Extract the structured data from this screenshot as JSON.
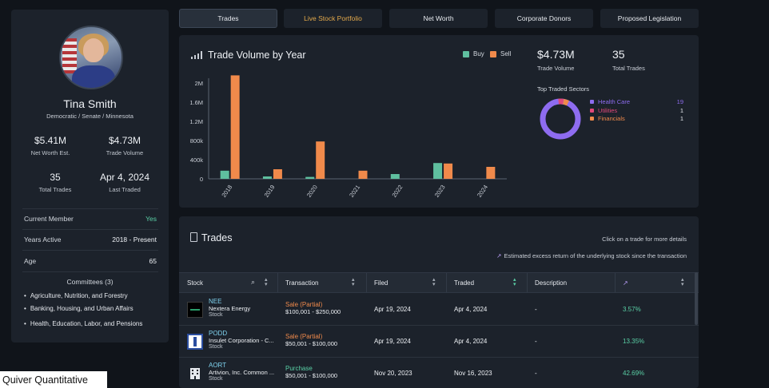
{
  "tabs": [
    "Trades",
    "Live Stock Portfolio",
    "Net Worth",
    "Corporate Donors",
    "Proposed Legislation"
  ],
  "profile": {
    "name": "Tina Smith",
    "subtitle": "Democratic / Senate / Minnesota",
    "net_worth": "$5.41M",
    "net_worth_label": "Net Worth Est.",
    "trade_volume": "$4.73M",
    "trade_volume_label": "Trade Volume",
    "total_trades": "35",
    "total_trades_label": "Total Trades",
    "last_traded": "Apr 4, 2024",
    "last_traded_label": "Last Traded",
    "current_member_label": "Current Member",
    "current_member": "Yes",
    "years_active_label": "Years Active",
    "years_active": "2018 - Present",
    "age_label": "Age",
    "age": "65",
    "committees_title": "Committees (3)",
    "committees": [
      "Agriculture, Nutrition, and Forestry",
      "Banking, Housing, and Urban Affairs",
      "Health, Education, Labor, and Pensions"
    ]
  },
  "summary": {
    "trade_volume": "$4.73M",
    "trade_volume_label": "Trade Volume",
    "total_trades": "35",
    "total_trades_label": "Total Trades",
    "sectors_title": "Top Traded Sectors",
    "sectors": [
      {
        "name": "Health Care",
        "count": "19",
        "color": "#8e6cf0"
      },
      {
        "name": "Utilities",
        "count": "1",
        "color": "#e0487a"
      },
      {
        "name": "Financials",
        "count": "1",
        "color": "#f08a4b"
      }
    ]
  },
  "chart_data": {
    "type": "bar",
    "title": "Trade Volume by Year",
    "categories": [
      "2018",
      "2019",
      "2020",
      "2021",
      "2022",
      "2023",
      "2024"
    ],
    "series": [
      {
        "name": "Buy",
        "color": "#5fbf9f",
        "values": [
          170000,
          50000,
          40000,
          0,
          100000,
          330000,
          0
        ]
      },
      {
        "name": "Sell",
        "color": "#f08a4b",
        "values": [
          2160000,
          200000,
          780000,
          170000,
          0,
          320000,
          250000
        ]
      }
    ],
    "y_ticks": [
      "0",
      "400k",
      "800k",
      "1.2M",
      "1.6M",
      "2M"
    ],
    "ylim": [
      0,
      2400000
    ],
    "legend": "top-right"
  },
  "trades": {
    "title": "Trades",
    "hint1": "Click on a trade for more details",
    "hint2": "Estimated excess return of the underlying stock since the transaction",
    "columns": [
      "Stock",
      "Transaction",
      "Filed",
      "Traded",
      "Description"
    ],
    "rows": [
      {
        "ticker": "NEE",
        "company": "Nextera Energy",
        "type": "Stock",
        "transaction": "Sale (Partial)",
        "amount": "$100,001 - $250,000",
        "filed": "Apr 19, 2024",
        "traded": "Apr 4, 2024",
        "description": "-",
        "return": "3.57%"
      },
      {
        "ticker": "PODD",
        "company": "Insulet Corporation - C...",
        "type": "Stock",
        "transaction": "Sale (Partial)",
        "amount": "$50,001 - $100,000",
        "filed": "Apr 19, 2024",
        "traded": "Apr 4, 2024",
        "description": "-",
        "return": "13.35%"
      },
      {
        "ticker": "AORT",
        "company": "Artivion, Inc. Common ...",
        "type": "Stock",
        "transaction": "Purchase",
        "amount": "$50,001 - $100,000",
        "filed": "Nov 20, 2023",
        "traded": "Nov 16, 2023",
        "description": "-",
        "return": "42.69%"
      }
    ]
  },
  "watermark": "Quiver Quantitative"
}
